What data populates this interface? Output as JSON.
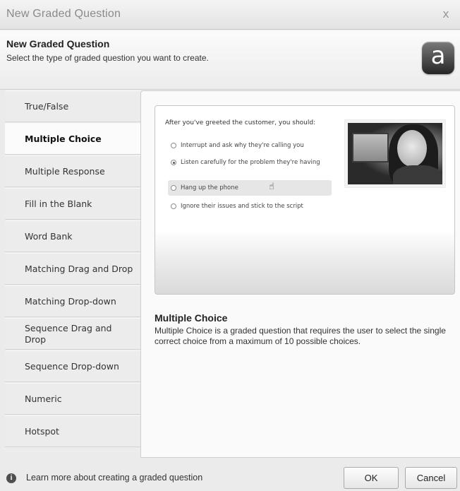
{
  "window": {
    "title": "New Graded Question",
    "close_label": "x"
  },
  "header": {
    "title": "New Graded Question",
    "subtitle": "Select the type of graded question you want to create.",
    "logo_letter": "a"
  },
  "sidebar": {
    "items": [
      {
        "label": "True/False",
        "active": false
      },
      {
        "label": "Multiple Choice",
        "active": true
      },
      {
        "label": "Multiple Response",
        "active": false
      },
      {
        "label": "Fill in the Blank",
        "active": false
      },
      {
        "label": "Word Bank",
        "active": false
      },
      {
        "label": "Matching Drag and Drop",
        "active": false
      },
      {
        "label": "Matching Drop-down",
        "active": false
      },
      {
        "label": "Sequence Drag and Drop",
        "active": false
      },
      {
        "label": "Sequence Drop-down",
        "active": false
      },
      {
        "label": "Numeric",
        "active": false
      },
      {
        "label": "Hotspot",
        "active": false
      }
    ]
  },
  "preview": {
    "question": "After you've greeted the customer, you should:",
    "options": [
      {
        "label": "Interrupt and ask why they're calling you",
        "selected": false
      },
      {
        "label": "Listen carefully for the problem they're having",
        "selected": true
      },
      {
        "label": "Hang up the phone",
        "selected": false,
        "hover": true
      },
      {
        "label": "Ignore their issues and stick to the script",
        "selected": false
      }
    ]
  },
  "description": {
    "title": "Multiple Choice",
    "text": "Multiple Choice is a graded question that requires the user to select the single correct choice from a maximum of 10 possible choices."
  },
  "footer": {
    "info_icon": "i",
    "learn_more": "Learn more about creating a graded question",
    "ok_label": "OK",
    "cancel_label": "Cancel"
  }
}
